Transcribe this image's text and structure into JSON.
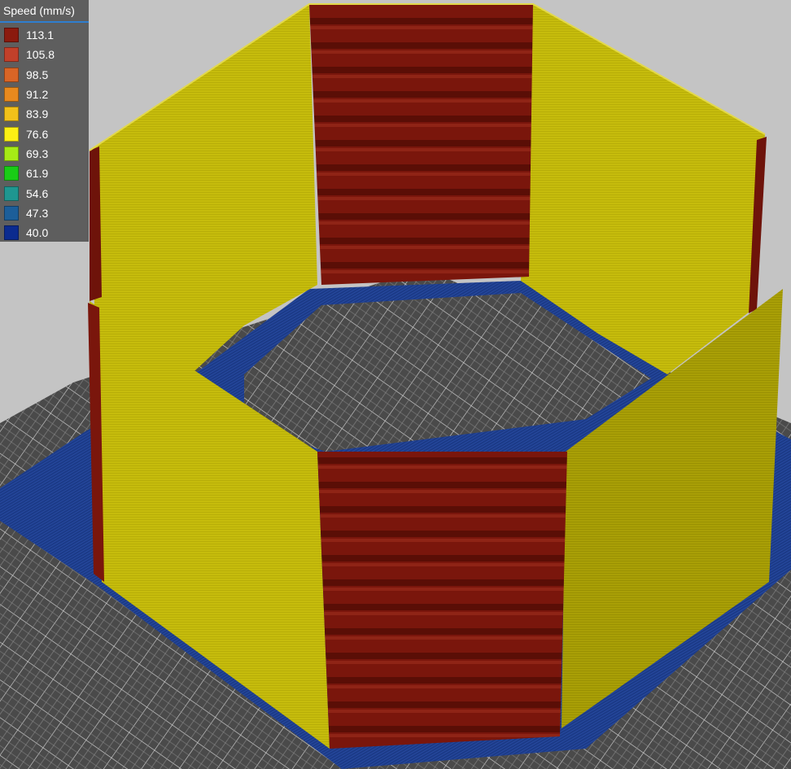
{
  "legend": {
    "title": "Speed (mm/s)",
    "items": [
      {
        "value": "113.1",
        "color": "#8b1a0e"
      },
      {
        "value": "105.8",
        "color": "#c2402a"
      },
      {
        "value": "98.5",
        "color": "#d96526"
      },
      {
        "value": "91.2",
        "color": "#e8891e"
      },
      {
        "value": "83.9",
        "color": "#f2c11a"
      },
      {
        "value": "76.6",
        "color": "#fcef14"
      },
      {
        "value": "69.3",
        "color": "#a6eb16"
      },
      {
        "value": "61.9",
        "color": "#19cc16"
      },
      {
        "value": "54.6",
        "color": "#1f9690"
      },
      {
        "value": "47.3",
        "color": "#1c5e99"
      },
      {
        "value": "40.0",
        "color": "#0b2b8f"
      }
    ]
  },
  "scene": {
    "object": "octagonal-vase-gcode-preview",
    "colors": {
      "background": "#c4c4c4",
      "bed": "#4a4a4a",
      "grid_line": "#d8d8d8",
      "brim": "#1b3a87",
      "yellow_wall": "#c6bc0c",
      "yellow_wall_dark": "#a79d05",
      "red_wall": "#7a160c",
      "red_wall_dark": "#5e0f07"
    }
  }
}
